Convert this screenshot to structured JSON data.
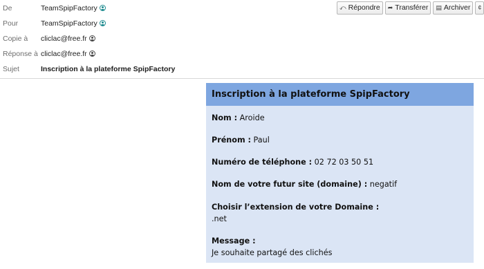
{
  "header": {
    "rows": [
      {
        "label": "De",
        "value": "TeamSpipFactory",
        "icon": "contact-icon-teal"
      },
      {
        "label": "Pour",
        "value": "TeamSpipFactory",
        "icon": "contact-icon-teal"
      },
      {
        "label": "Copie à",
        "value": "cliclac@free.fr",
        "icon": "contact-icon"
      },
      {
        "label": "Réponse à",
        "value": "cliclac@free.fr",
        "icon": "contact-icon"
      },
      {
        "label": "Sujet",
        "value": "Inscription à la plateforme SpipFactory"
      }
    ],
    "toolbar": {
      "reply": {
        "icon": "⤺",
        "label": "Répondre"
      },
      "forward": {
        "icon": "➦",
        "label": "Transférer"
      },
      "archive": {
        "icon": "▤",
        "label": "Archiver"
      },
      "more_icon": "¢"
    }
  },
  "message": {
    "title": "Inscription à la plateforme SpipFactory",
    "fields": [
      {
        "label": "Nom :",
        "value": " Aroide"
      },
      {
        "label": "Prénom :",
        "value": " Paul"
      },
      {
        "label": "Numéro de téléphone :",
        "value": " 02 72 03 50 51"
      },
      {
        "label": "Nom de votre futur site (domaine) :",
        "value": " negatif"
      },
      {
        "label": "Choisir l’extension de votre Domaine :",
        "value": ".net"
      },
      {
        "label": "Message :",
        "value": "Je souhaite partagé des clichés"
      }
    ]
  },
  "colors": {
    "card_background": "#dbe5f5",
    "card_title_background": "#7ea6e0",
    "contact_icon_teal": "#1d8b8f"
  }
}
